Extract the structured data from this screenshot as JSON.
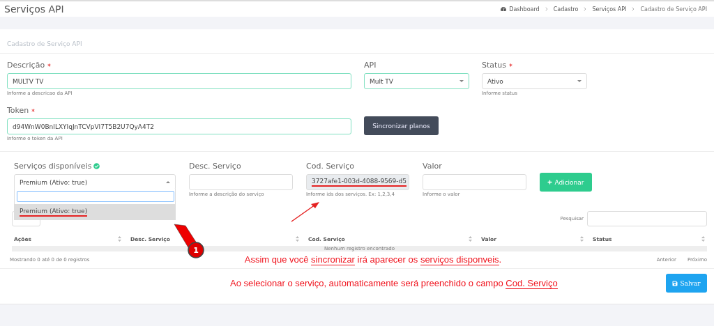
{
  "header": {
    "title": "Serviços API",
    "breadcrumb": [
      {
        "label": "Dashboard",
        "icon": true
      },
      {
        "label": "Cadastro",
        "icon": false
      },
      {
        "label": "Serviços API",
        "icon": false
      },
      {
        "label": "Cadastro de Serviço API",
        "icon": false
      }
    ]
  },
  "card": {
    "title": "Cadastro de Serviço API"
  },
  "form": {
    "descricao": {
      "label": "Descrição",
      "required": true,
      "value": "MULTV TV",
      "hint": "Informe a descricao da API"
    },
    "api": {
      "label": "API",
      "required": false,
      "value": "Mult TV"
    },
    "status": {
      "label": "Status",
      "required": true,
      "value": "Ativo",
      "hint": "Informe status"
    },
    "token": {
      "label": "Token",
      "required": true,
      "value": "d94WnW0BnILXYIqJnTCVpVI7T5B2U7QyA4T2",
      "hint": "Informe o token da API"
    },
    "sync_button": "Sincronizar planos"
  },
  "services": {
    "available": {
      "label": "Serviços disponíveis",
      "verified": true,
      "value": "Premium (Ativo: true)",
      "expanded": true,
      "options": [
        {
          "label": "Premium (Ativo: true)",
          "selected": true,
          "underlined": true
        }
      ]
    },
    "desc": {
      "label": "Desc. Serviço",
      "hint": "Informe a descrição do serviço"
    },
    "cod": {
      "label": "Cod. Serviço",
      "value": "3727afe1-003d-4088-9569-d5",
      "hint": "Informe ids dos serviços. Ex: 1,2,3,4",
      "disabled": true,
      "underlined": true
    },
    "valor": {
      "label": "Valor",
      "hint": "Informe o valor"
    },
    "add_button": "Adicionar"
  },
  "table": {
    "search_label": "Pesquisar",
    "columns": [
      "Ações",
      "Desc. Serviço",
      "Cod. Serviço",
      "Valor",
      "Status"
    ],
    "empty": "Nenhum registro encontrado",
    "info": "Mostrando 0 até 0 de 0 registros",
    "pagination": [
      "Anterior",
      "Próximo"
    ]
  },
  "save_button": "Salvar",
  "annotations": {
    "badge": "1",
    "notes": [
      [
        {
          "text": "Assim que você ",
          "underlined": false
        },
        {
          "text": "sincronizar",
          "underlined": true
        },
        {
          "text": " irá aparecer os ",
          "underlined": false
        },
        {
          "text": "serviços disponveis",
          "underlined": true
        },
        {
          "text": ".",
          "underlined": false
        }
      ],
      [
        {
          "text": "Ao selecionar o serviço, automaticamente será preenchido o campo ",
          "underlined": false
        },
        {
          "text": "Cod. Serviço",
          "underlined": true
        }
      ]
    ]
  }
}
